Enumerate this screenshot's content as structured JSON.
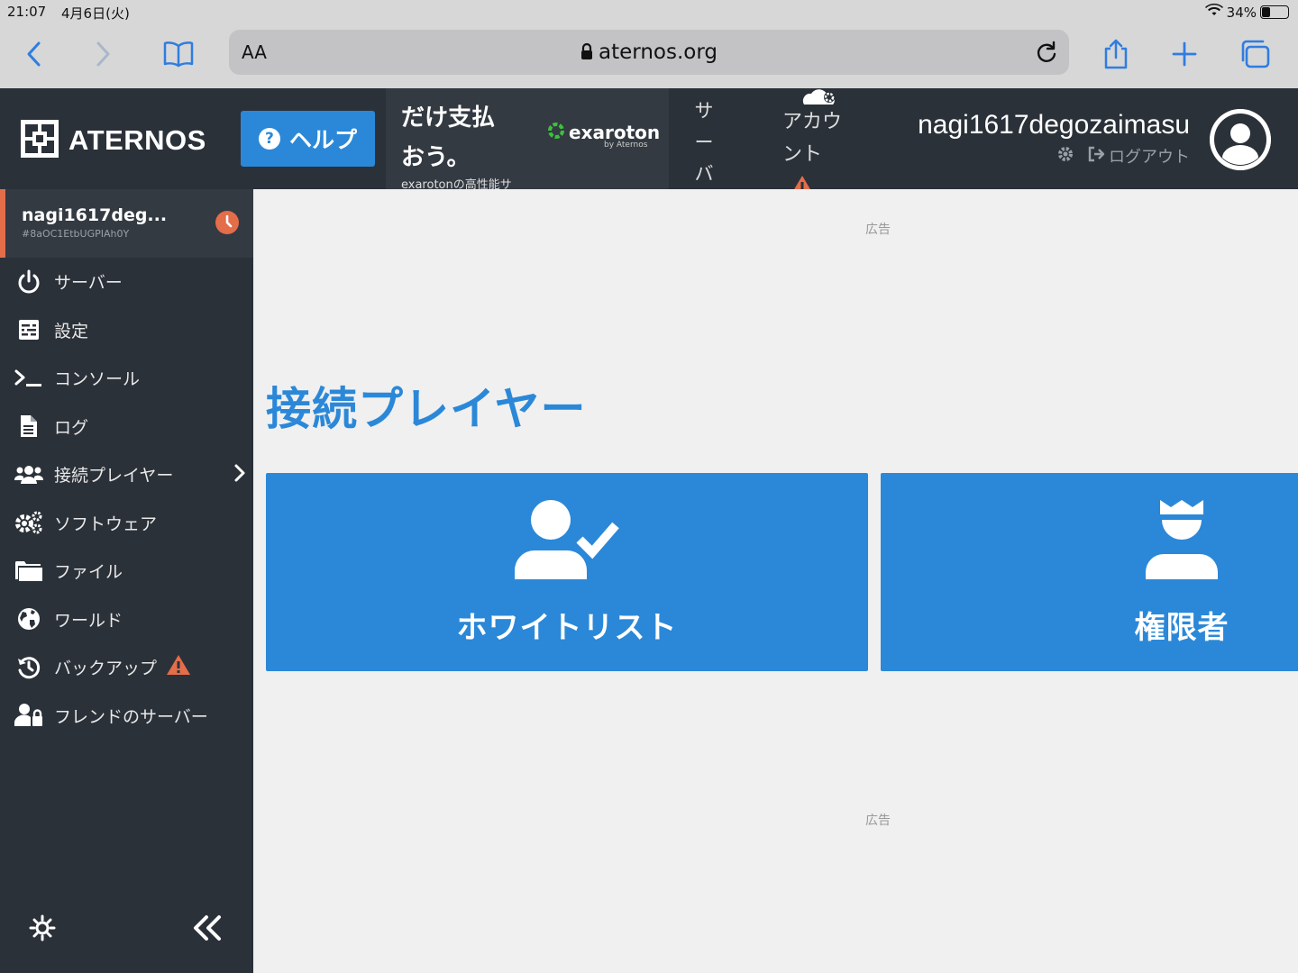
{
  "status_bar": {
    "time": "21:07",
    "date": "4月6日(火)",
    "battery": "34%",
    "battery_level": 0.34
  },
  "browser": {
    "text_size": "AA",
    "url": "aternos.org"
  },
  "header": {
    "brand": "ATERNOS",
    "help_label": "ヘルプ",
    "ad": {
      "line1": "だけ支払",
      "line2": "おう。",
      "line3": "exarotonの高性能サ",
      "logo_name": "exaroton",
      "logo_by": "by Aternos"
    },
    "server_nav": [
      "サ",
      "ー",
      "バ"
    ],
    "account_nav": [
      "アカウ",
      "ント"
    ],
    "username": "nagi1617degozaimasu",
    "logout_label": "ログアウト"
  },
  "sidebar": {
    "server_name": "nagi1617deg...",
    "server_id": "#8aOC1EtbUGPIAh0Y",
    "items": [
      {
        "label": "サーバー",
        "icon": "power-icon"
      },
      {
        "label": "設定",
        "icon": "sliders-icon"
      },
      {
        "label": "コンソール",
        "icon": "terminal-icon"
      },
      {
        "label": "ログ",
        "icon": "file-icon"
      },
      {
        "label": "接続プレイヤー",
        "icon": "users-icon"
      },
      {
        "label": "ソフトウェア",
        "icon": "gears-icon"
      },
      {
        "label": "ファイル",
        "icon": "folder-icon"
      },
      {
        "label": "ワールド",
        "icon": "globe-icon"
      },
      {
        "label": "バックアップ",
        "icon": "history-icon"
      },
      {
        "label": "フレンドのサーバー",
        "icon": "user-lock-icon"
      }
    ]
  },
  "main": {
    "ad_label_top": "広告",
    "ad_label_bottom": "広告",
    "title": "接続プレイヤー",
    "cards": [
      {
        "label": "ホワイトリスト",
        "icon": "user-check-icon"
      },
      {
        "label": "権限者",
        "icon": "user-crown-icon"
      }
    ]
  },
  "colors": {
    "accent": "#2b88d8",
    "dark_bg": "#2b3139",
    "warning": "#e46d4a",
    "page_bg": "#f0f0f0"
  }
}
